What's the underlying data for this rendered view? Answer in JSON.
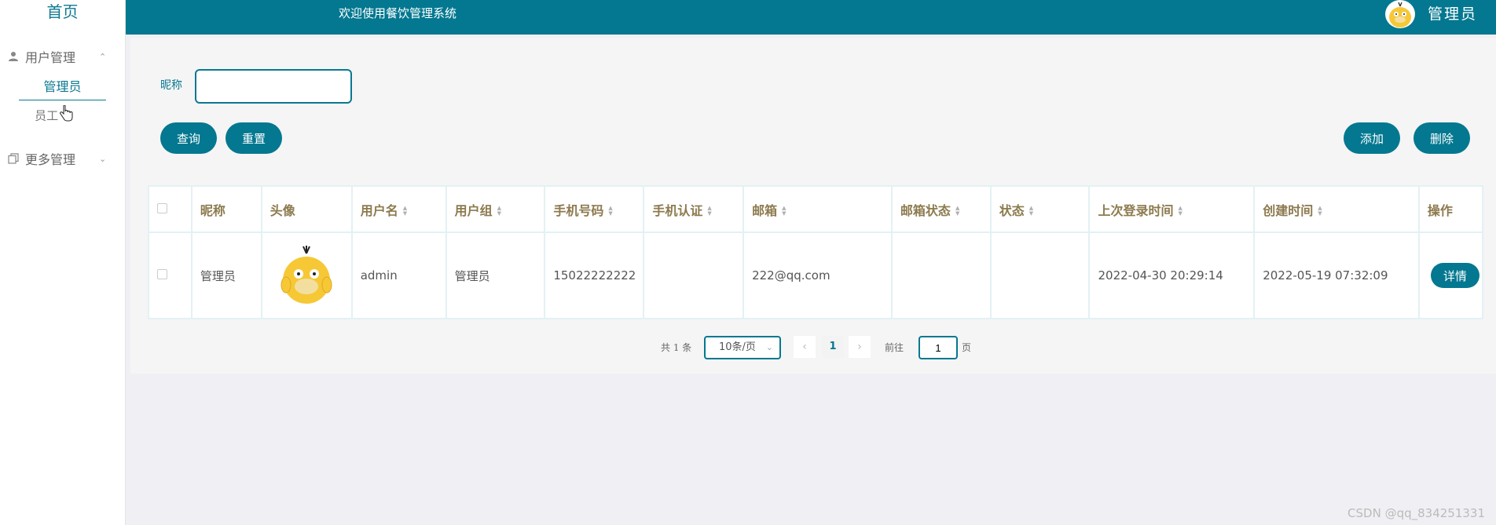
{
  "sidebar": {
    "home": "首页",
    "groups": [
      {
        "label": "用户管理",
        "icon": "user-icon",
        "items": [
          "管理员",
          "员工"
        ]
      },
      {
        "label": "更多管理",
        "icon": "copy-icon"
      }
    ]
  },
  "header": {
    "title": "欢迎使用餐饮管理系统",
    "user": "管理员"
  },
  "search": {
    "label": "昵称",
    "value": "",
    "placeholder": ""
  },
  "toolbar": {
    "query": "查询",
    "reset": "重置",
    "add": "添加",
    "delete": "删除"
  },
  "table": {
    "columns": [
      "昵称",
      "头像",
      "用户名",
      "用户组",
      "手机号码",
      "手机认证",
      "邮箱",
      "邮箱状态",
      "状态",
      "上次登录时间",
      "创建时间",
      "操作"
    ],
    "rows": [
      {
        "nickname": "管理员",
        "username": "admin",
        "group": "管理员",
        "phone": "15022222222",
        "phone_verify": "",
        "email": "222@qq.com",
        "email_status": "",
        "status": "",
        "last_login": "2022-04-30 20:29:14",
        "created": "2022-05-19 07:32:09",
        "action": "详情"
      }
    ]
  },
  "pagination": {
    "total": "共 1 条",
    "page_size": "10条/页",
    "current": "1",
    "goto_prefix": "前往",
    "goto_value": "1",
    "goto_suffix": "页"
  },
  "watermark": "CSDN @qq_834251331",
  "colors": {
    "primary": "#037890",
    "header_text": "#8c7a4e"
  }
}
